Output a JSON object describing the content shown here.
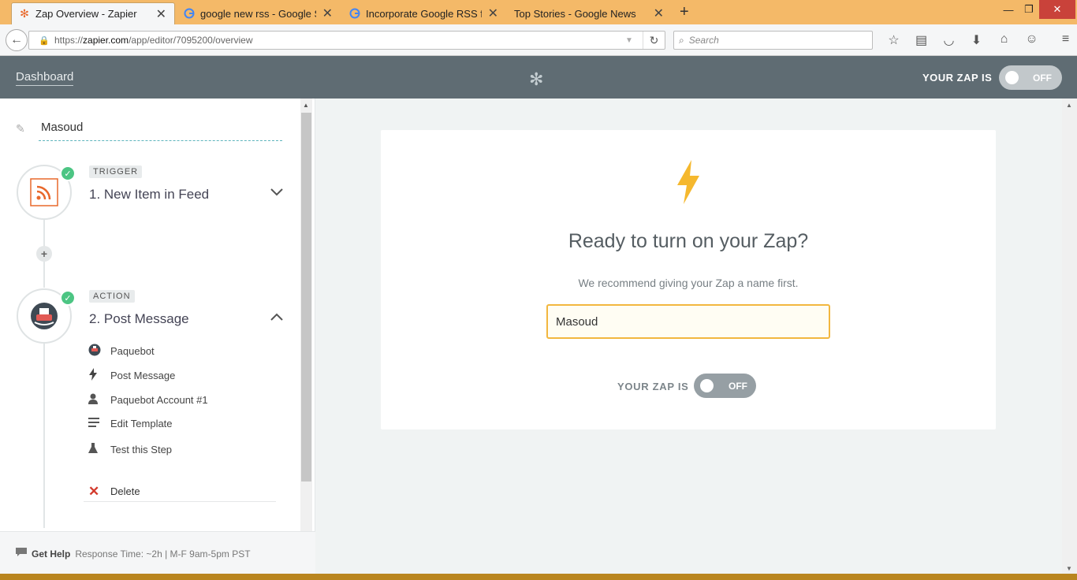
{
  "browser": {
    "tabs": [
      {
        "title": "Zap Overview - Zapier",
        "active": true
      },
      {
        "title": "google new rss - Google S...",
        "active": false
      },
      {
        "title": "Incorporate Google RSS fe...",
        "active": false
      },
      {
        "title": "Top Stories - Google News",
        "active": false
      }
    ],
    "url_prefix": "https://",
    "url_domain": "zapier.com",
    "url_path": "/app/editor/7095200/overview",
    "search_placeholder": "Search"
  },
  "header": {
    "dashboard_label": "Dashboard",
    "zap_status_label": "YOUR ZAP IS",
    "toggle_state": "OFF"
  },
  "sidebar": {
    "zap_name": "Masoud",
    "trigger": {
      "badge": "TRIGGER",
      "title": "1. New Item in Feed"
    },
    "action": {
      "badge": "ACTION",
      "title": "2. Post Message",
      "items": [
        {
          "label": "Paquebot",
          "icon": "paquebot-app-icon"
        },
        {
          "label": "Post Message",
          "icon": "bolt-icon"
        },
        {
          "label": "Paquebot Account #1",
          "icon": "user-icon"
        },
        {
          "label": "Edit Template",
          "icon": "list-icon"
        },
        {
          "label": "Test this Step",
          "icon": "flask-icon"
        }
      ],
      "delete_label": "Delete"
    },
    "help": {
      "label": "Get Help",
      "response": "Response Time: ~2h | M-F 9am-5pm PST"
    }
  },
  "card": {
    "title": "Ready to turn on your Zap?",
    "subtitle": "We recommend giving your Zap a name first.",
    "name_value": "Masoud",
    "zap_status_label": "YOUR ZAP IS",
    "toggle_state": "OFF"
  },
  "colors": {
    "accent": "#f2b73f",
    "header": "#5f6c73",
    "success": "#4cc583",
    "danger": "#d33a2c",
    "rss": "#e8682b"
  }
}
